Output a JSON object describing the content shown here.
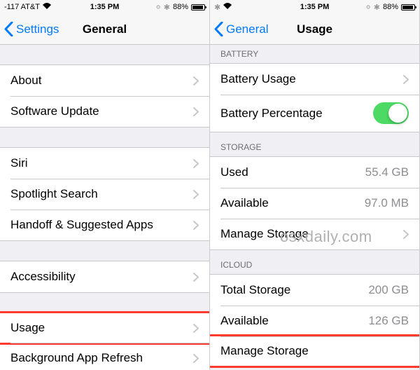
{
  "status": {
    "carrier": "-117 AT&T",
    "wifi": "⏚",
    "time": "1:35 PM",
    "battery_pct": "88%"
  },
  "left": {
    "back": "Settings",
    "title": "General",
    "rows": {
      "about": "About",
      "software_update": "Software Update",
      "siri": "Siri",
      "spotlight": "Spotlight Search",
      "handoff": "Handoff & Suggested Apps",
      "accessibility": "Accessibility",
      "usage": "Usage",
      "background_refresh": "Background App Refresh"
    }
  },
  "right": {
    "back": "General",
    "title": "Usage",
    "sections": {
      "battery": "BATTERY",
      "storage": "STORAGE",
      "icloud": "ICLOUD"
    },
    "rows": {
      "battery_usage": "Battery Usage",
      "battery_percentage": "Battery Percentage",
      "used": "Used",
      "used_val": "55.4 GB",
      "available": "Available",
      "available_val": "97.0 MB",
      "manage_storage": "Manage Storage",
      "total_storage": "Total Storage",
      "total_storage_val": "200 GB",
      "icloud_available": "Available",
      "icloud_available_val": "126 GB",
      "icloud_manage": "Manage Storage"
    }
  },
  "watermark": "osxdaily.com"
}
